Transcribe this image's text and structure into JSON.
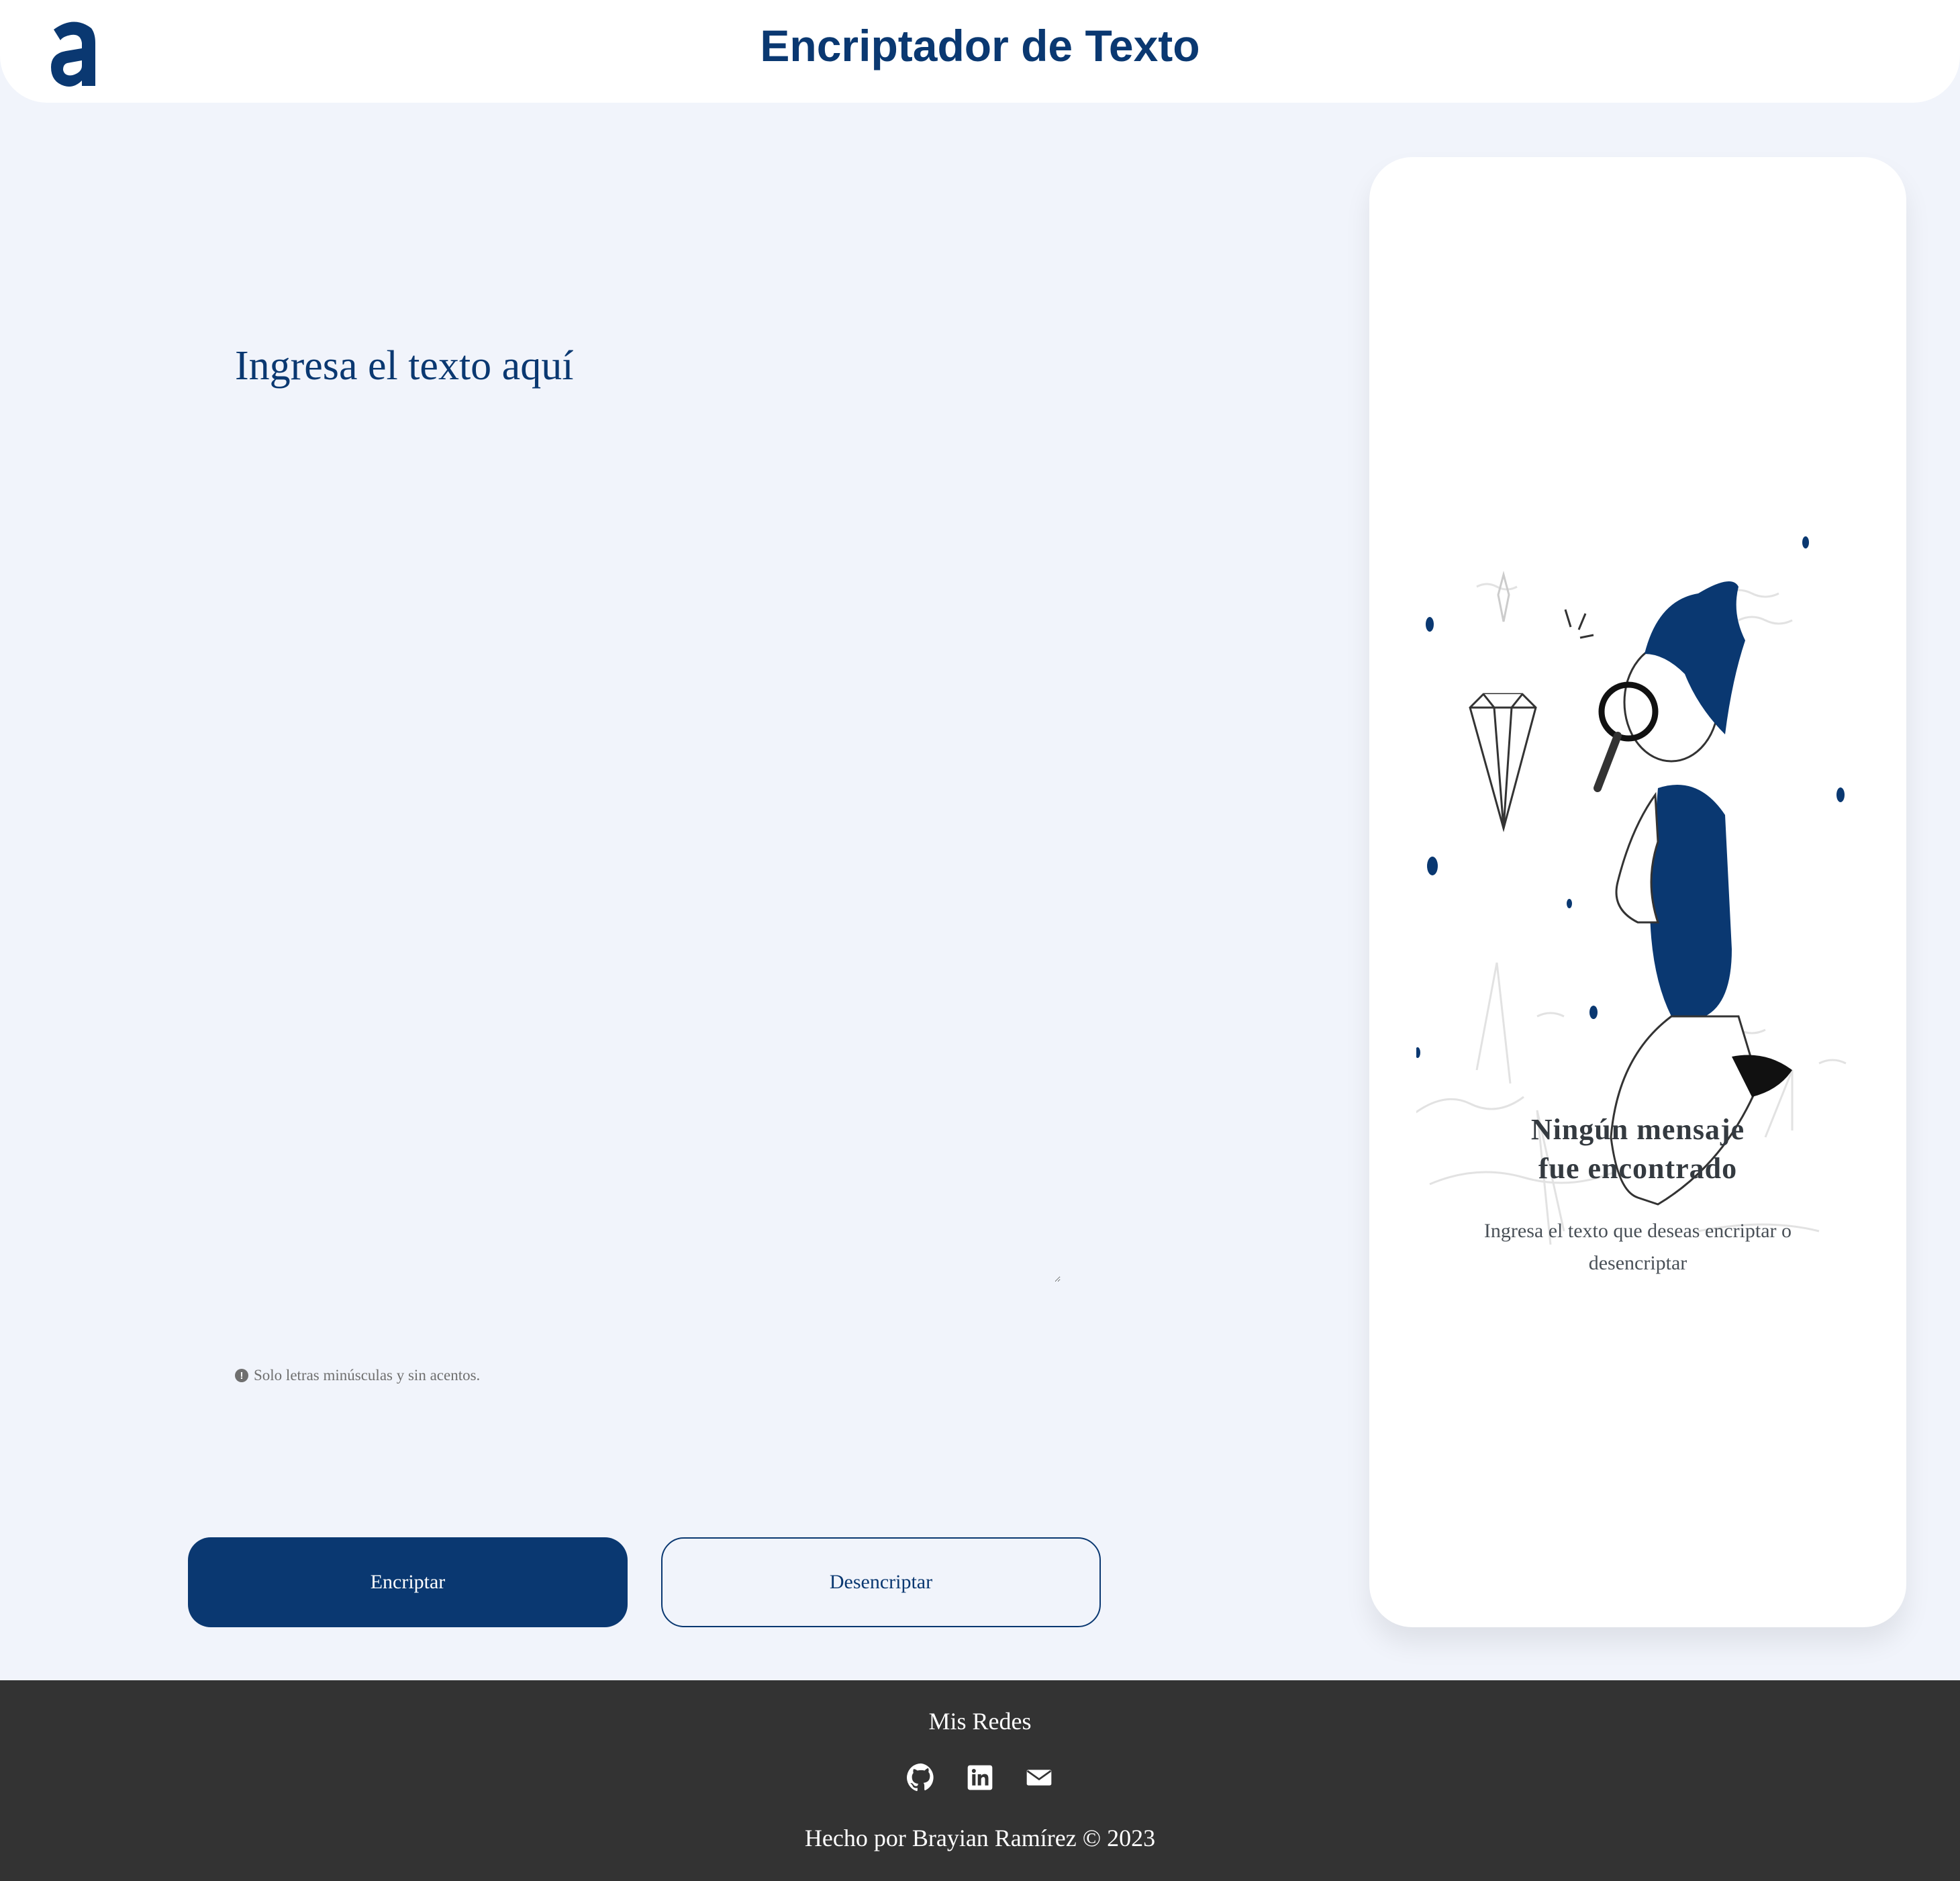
{
  "colors": {
    "brand": "#0a3871",
    "background": "#f1f4fb",
    "footer": "#333333"
  },
  "header": {
    "logo_icon": "alura-logo-icon",
    "title": "Encriptador de Texto"
  },
  "input": {
    "placeholder": "Ingresa el texto aquí",
    "value": ""
  },
  "hint": {
    "icon": "exclamation-circle-icon",
    "text": "Solo letras minúsculas y sin acentos."
  },
  "buttons": {
    "encrypt_label": "Encriptar",
    "decrypt_label": "Desencriptar"
  },
  "output_panel": {
    "illustration": "person-with-magnifier-illustration",
    "title": "Ningún mensaje\nfue encontrado",
    "text": "Ingresa el texto que deseas encriptar o desencriptar"
  },
  "footer": {
    "heading": "Mis Redes",
    "socials": [
      {
        "icon": "github-icon"
      },
      {
        "icon": "linkedin-icon"
      },
      {
        "icon": "email-icon"
      }
    ],
    "credit": "Hecho por Brayian Ramírez © 2023"
  }
}
